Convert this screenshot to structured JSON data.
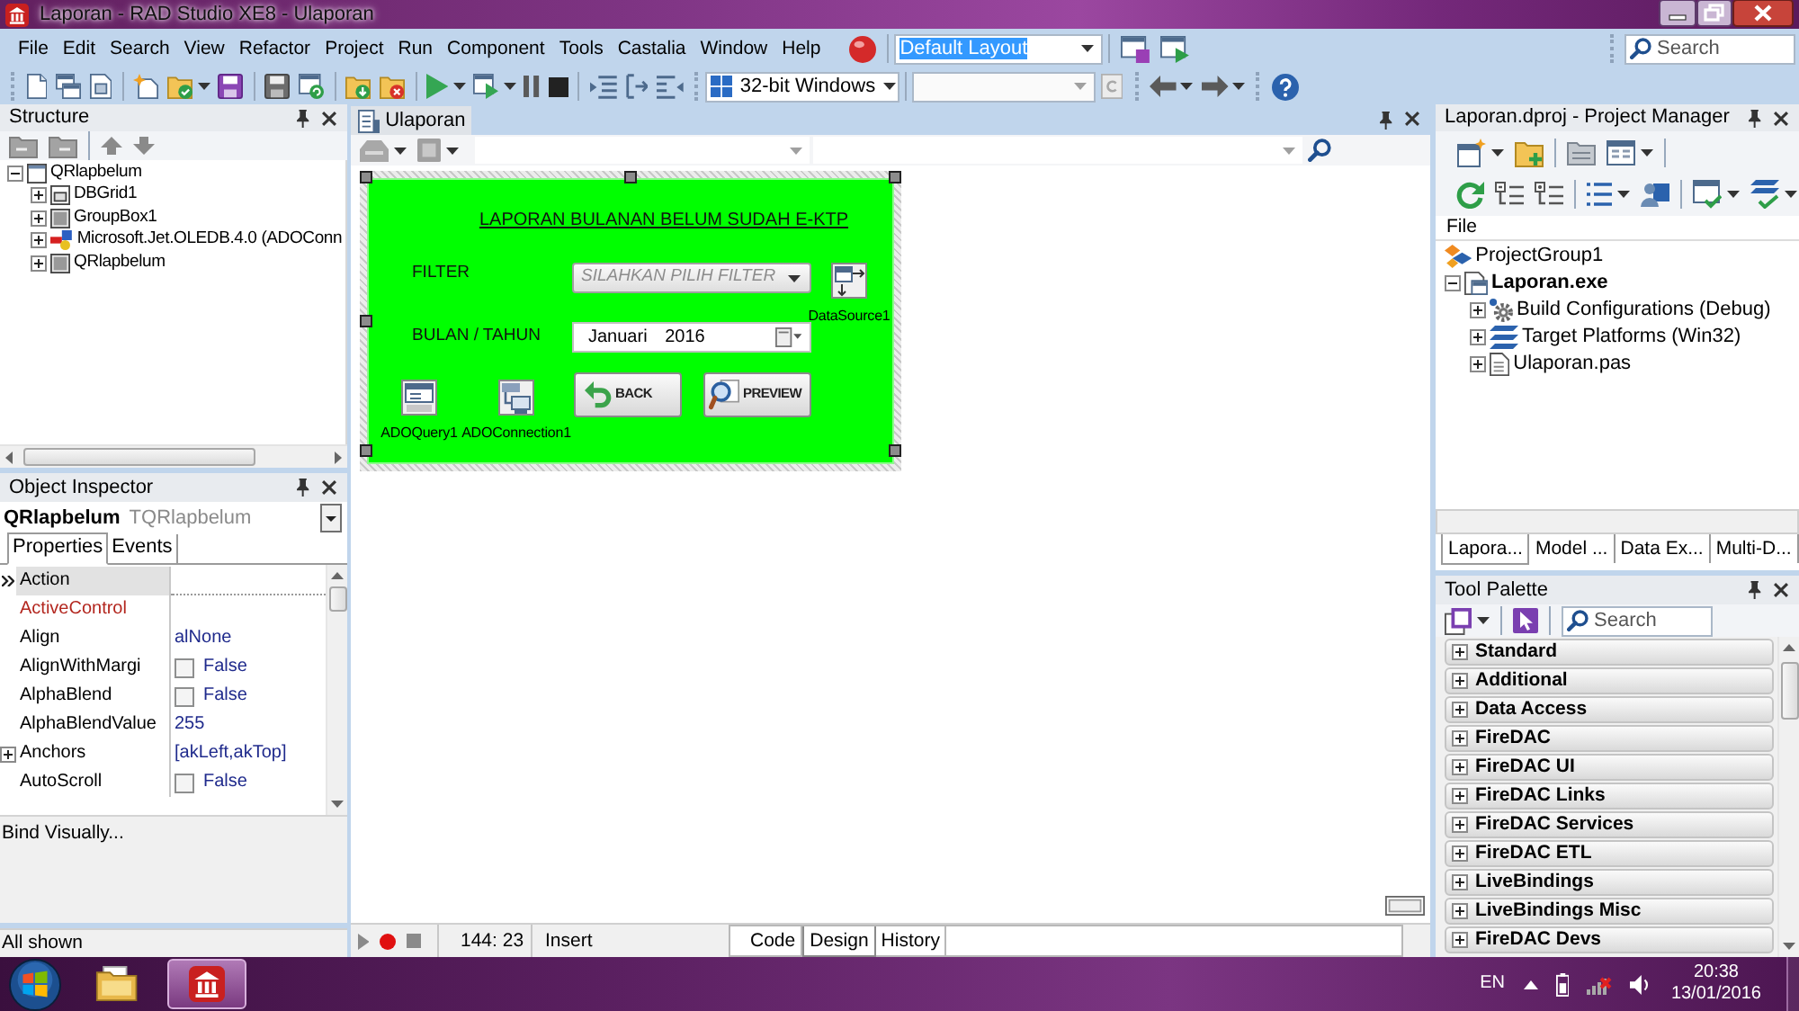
{
  "window": {
    "title": "Laporan - RAD Studio XE8 - Ulaporan"
  },
  "menu": [
    "File",
    "Edit",
    "Search",
    "View",
    "Refactor",
    "Project",
    "Run",
    "Component",
    "Tools",
    "Castalia",
    "Window",
    "Help"
  ],
  "layout_combo": {
    "value": "Default Layout",
    "highlighted": true
  },
  "ide_search": {
    "placeholder": "Search"
  },
  "platform_combo": {
    "value": "32-bit Windows"
  },
  "structure": {
    "title": "Structure",
    "tree": [
      {
        "label": "QRlapbelum",
        "kind": "form",
        "expanded": true,
        "children": [
          {
            "label": "DBGrid1",
            "kind": "grid",
            "expanded": false
          },
          {
            "label": "GroupBox1",
            "kind": "panel",
            "expanded": false
          },
          {
            "label": "Microsoft.Jet.OLEDB.4.0 (ADOConn",
            "kind": "connection",
            "expanded": false
          },
          {
            "label": "QRlapbelum",
            "kind": "panel",
            "expanded": false
          }
        ]
      }
    ]
  },
  "object_inspector": {
    "title": "Object Inspector",
    "object_name": "QRlapbelum",
    "object_type": "TQRlapbelum",
    "tabs": [
      {
        "label": "Properties",
        "selected": true
      },
      {
        "label": "Events",
        "selected": false
      }
    ],
    "properties": [
      {
        "name": "Action",
        "kind": "text",
        "selected": true
      },
      {
        "name": "ActiveControl",
        "kind": "reference",
        "selected": false
      },
      {
        "name": "Align",
        "kind": "text",
        "value": "alNone",
        "selected": false
      },
      {
        "name": "AlignWithMargi",
        "kind": "bool",
        "checked": false,
        "value": "False",
        "selected": false
      },
      {
        "name": "AlphaBlend",
        "kind": "bool",
        "checked": false,
        "value": "False",
        "selected": false
      },
      {
        "name": "AlphaBlendValue",
        "kind": "text",
        "value": "255",
        "selected": false
      },
      {
        "name": "Anchors",
        "kind": "set",
        "expanded": false,
        "value": "[akLeft,akTop]",
        "selected": false
      },
      {
        "name": "AutoScroll",
        "kind": "bool",
        "checked": false,
        "value": "False",
        "selected": false
      }
    ],
    "footer_link": "Bind Visually...",
    "status": "All shown"
  },
  "editor": {
    "tab": {
      "label": "Ulaporan",
      "selected": true
    },
    "form": {
      "title": "LAPORAN BULANAN BELUM SUDAH E-KTP",
      "filter_label": "FILTER",
      "filter_combo": {
        "text": "SILAHKAN PILIH FILTER"
      },
      "period_label": "BULAN / TAHUN",
      "period_picker": {
        "value": "Januari 2016"
      },
      "components": [
        {
          "label": "DataSource1",
          "kind": "datasource"
        },
        {
          "label": "ADOQuery1",
          "kind": "query"
        },
        {
          "label": "ADOConnection1",
          "kind": "connection"
        }
      ],
      "buttons": [
        {
          "label": "BACK",
          "kind": "back"
        },
        {
          "label": "PREVIEW",
          "kind": "preview"
        }
      ]
    },
    "cursor_position": "144: 23",
    "insert_mode": "Insert",
    "view_tabs": [
      {
        "label": "Code",
        "selected": false
      },
      {
        "label": "Design",
        "selected": true
      },
      {
        "label": "History",
        "selected": false
      }
    ]
  },
  "project_manager": {
    "title": "Laporan.dproj - Project Manager",
    "column": "File",
    "tree": [
      {
        "label": "ProjectGroup1",
        "kind": "group",
        "children": [
          {
            "label": "Laporan.exe",
            "kind": "project",
            "expanded": true,
            "children": [
              {
                "label": "Build Configurations (Debug)",
                "kind": "configs",
                "expanded": false
              },
              {
                "label": "Target Platforms (Win32)",
                "kind": "platforms",
                "expanded": false
              },
              {
                "label": "Ulaporan.pas",
                "kind": "unit",
                "expanded": false
              }
            ]
          }
        ]
      }
    ],
    "tabs": [
      {
        "label": "Lapora...",
        "selected": true
      },
      {
        "label": "Model ...",
        "selected": false
      },
      {
        "label": "Data Ex...",
        "selected": false
      },
      {
        "label": "Multi-D...",
        "selected": false
      }
    ]
  },
  "tool_palette": {
    "title": "Tool Palette",
    "search": {
      "placeholder": "Search"
    },
    "categories": [
      {
        "label": "Standard",
        "expanded": false
      },
      {
        "label": "Additional",
        "expanded": false
      },
      {
        "label": "Data Access",
        "expanded": false
      },
      {
        "label": "FireDAC",
        "expanded": false
      },
      {
        "label": "FireDAC UI",
        "expanded": false
      },
      {
        "label": "FireDAC Links",
        "expanded": false
      },
      {
        "label": "FireDAC Services",
        "expanded": false
      },
      {
        "label": "FireDAC ETL",
        "expanded": false
      },
      {
        "label": "LiveBindings",
        "expanded": false
      },
      {
        "label": "LiveBindings Misc",
        "expanded": false
      },
      {
        "label": "FireDAC Devs",
        "expanded": false
      }
    ]
  },
  "taskbar": {
    "apps": [
      {
        "kind": "explorer",
        "selected": false
      },
      {
        "kind": "ide",
        "selected": true
      }
    ],
    "language": "EN",
    "time": "20:38",
    "date": "13/01/2016"
  }
}
